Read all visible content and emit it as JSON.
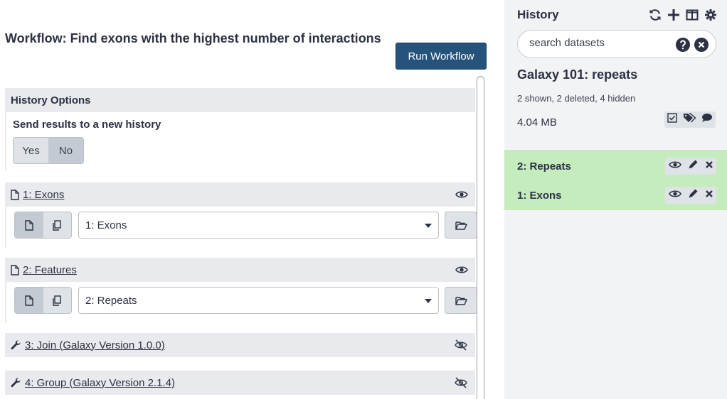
{
  "workflow": {
    "title": "Workflow: Find exons with the highest number of interactions",
    "run_label": "Run Workflow"
  },
  "history_options": {
    "header": "History Options",
    "send_label": "Send results to a new history",
    "yes_label": "Yes",
    "no_label": "No",
    "selected": "No"
  },
  "steps": [
    {
      "label": "1: Exons",
      "type": "dataset",
      "selected_value": "1: Exons",
      "visible": true
    },
    {
      "label": "2: Features",
      "type": "dataset",
      "selected_value": "2: Repeats",
      "visible": true
    },
    {
      "label": "3: Join (Galaxy Version 1.0.0)",
      "type": "tool",
      "visible": false
    },
    {
      "label": "4: Group (Galaxy Version 2.1.4)",
      "type": "tool",
      "visible": false
    }
  ],
  "history": {
    "panel_title": "History",
    "search_placeholder": "search datasets",
    "name": "Galaxy 101: repeats",
    "stats": "2 shown, 2 deleted, 4 hidden",
    "size": "4.04 MB",
    "datasets": [
      {
        "label": "2: Repeats",
        "state": "ok"
      },
      {
        "label": "1: Exons",
        "state": "ok"
      }
    ]
  },
  "colors": {
    "primary": "#25537b",
    "dataset_ok": "#c4ecbd",
    "panel_bg": "#f2f3f5",
    "card_header": "#e8eaed"
  }
}
